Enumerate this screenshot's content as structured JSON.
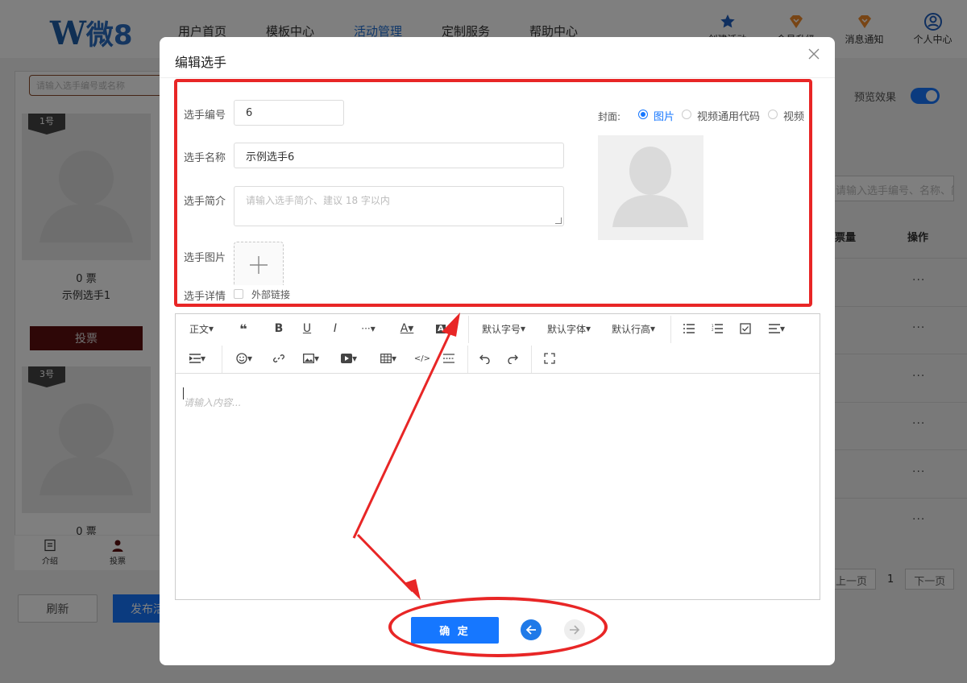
{
  "topnav": {
    "logo": {
      "w": "W",
      "text": "微8"
    },
    "links": [
      "用户首页",
      "模板中心",
      "活动管理",
      "定制服务",
      "帮助中心"
    ],
    "active_index": 2,
    "icons": [
      {
        "label": "创建活动",
        "icon": "star-icon",
        "color": "#1f5fbf"
      },
      {
        "label": "会员升级",
        "icon": "diamond-icon",
        "color": "#f08a2a"
      },
      {
        "label": "消息通知",
        "icon": "bell-icon",
        "color": "#f08a2a"
      },
      {
        "label": "个人中心",
        "icon": "user-icon",
        "color": "#1f5fbf"
      }
    ]
  },
  "preview": {
    "search_placeholder": "请输入选手编号或名称",
    "cards": [
      {
        "tag": "1号",
        "votes": "0 票",
        "name": "示例选手1",
        "vote_label": "投票"
      },
      {
        "tag": "3号",
        "votes": "0 票",
        "name": "",
        "vote_label": ""
      }
    ],
    "tabs": [
      {
        "label": "介绍",
        "icon": "list-icon"
      },
      {
        "label": "投票",
        "icon": "person-icon"
      }
    ],
    "refresh_label": "刷新",
    "publish_label": "发布活动"
  },
  "right_panel": {
    "preview_label": "预览效果",
    "preview_on": true,
    "search_placeholder": "请输入选手编号、名称、简介",
    "col_qty": "票量",
    "col_op": "操作",
    "row_action": "···",
    "pager": {
      "prev": "上一页",
      "page": "1",
      "next": "下一页"
    }
  },
  "modal": {
    "title": "编辑选手",
    "fields": {
      "number_label": "选手编号",
      "number_value": "6",
      "name_label": "选手名称",
      "name_value": "示例选手6",
      "intro_label": "选手简介",
      "intro_placeholder": "请输入选手简介、建议 18 字以内",
      "image_label": "选手图片",
      "detail_label": "选手详情",
      "external_link_label": "外部链接"
    },
    "cover": {
      "label": "封面:",
      "options": [
        "图片",
        "视频通用代码",
        "视频"
      ],
      "selected_index": 0
    },
    "editor": {
      "toolbar_row1": {
        "paragraph": "正文",
        "font_size": "默认字号",
        "font_family": "默认字体",
        "line_height": "默认行高"
      },
      "placeholder": "请输入内容..."
    },
    "confirm_label": "确 定"
  },
  "colors": {
    "accent": "#1677ff",
    "annotation_red": "#e82626",
    "vote_button": "#5c0f0f"
  }
}
